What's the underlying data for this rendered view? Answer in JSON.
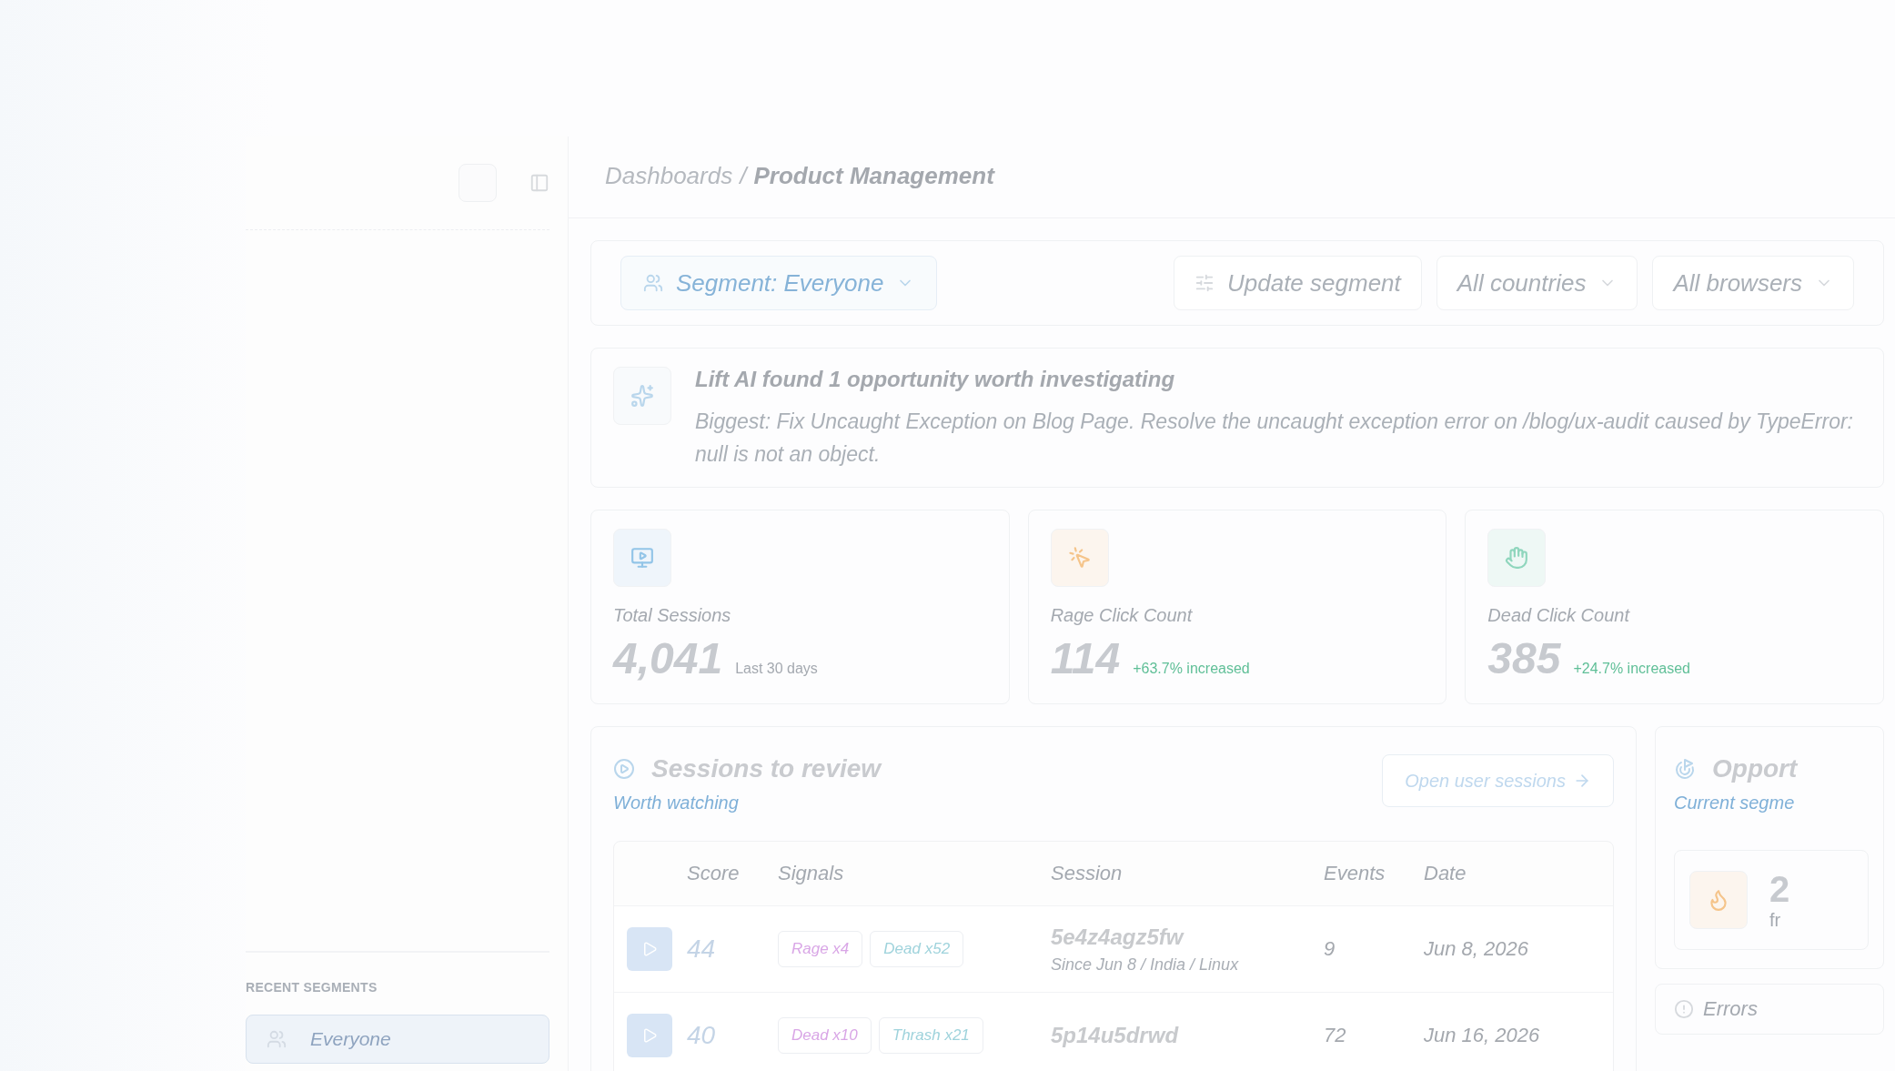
{
  "sidebar": {
    "section_title": "RECENT SEGMENTS",
    "segments": [
      {
        "label": "Everyone",
        "selected": true
      }
    ]
  },
  "breadcrumb": {
    "parent": "Dashboards",
    "separator": "/",
    "current": "Product Management"
  },
  "filters": {
    "segment": "Segment: Everyone",
    "update": "Update segment",
    "dropdowns": [
      "All countries",
      "All browsers"
    ]
  },
  "insight": {
    "title": "Lift AI found 1 opportunity worth investigating",
    "body": "Biggest: Fix Uncaught Exception on Blog Page. Resolve the uncaught exception error on /blog/ux-audit caused by TypeError: null is not an object."
  },
  "stats": [
    {
      "kind": "sessions",
      "label": "Total Sessions",
      "value": "4,041",
      "note": "Last 30 days",
      "color": "#93c5e8"
    },
    {
      "kind": "rage",
      "label": "Rage Click Count",
      "value": "114",
      "note": "+63.7% increased",
      "color": "#f5c48a"
    },
    {
      "kind": "dead",
      "label": "Dead Click Count",
      "value": "385",
      "note": "+24.7% increased",
      "color": "#8fd6bd"
    }
  ],
  "sessions": {
    "title": "Sessions to review",
    "subtitle": "Worth watching",
    "action": "Open user sessions",
    "columns": [
      "Score",
      "Signals",
      "Session",
      "Events",
      "Date"
    ],
    "rows": [
      {
        "score": "44",
        "signals": [
          {
            "label": "Rage x4",
            "color": "#d9a6e6"
          },
          {
            "label": "Dead x52",
            "color": "#9fd3dc"
          }
        ],
        "session": "5e4z4agz5fw",
        "meta": "Since Jun 8 / India / Linux",
        "events": "9",
        "date": "Jun 8, 2026"
      },
      {
        "score": "40",
        "signals": [
          {
            "label": "Dead x10",
            "color": "#d9a6e6"
          },
          {
            "label": "Thrash x21",
            "color": "#9fd3dc"
          }
        ],
        "session": "5p14u5drwd",
        "events": "72",
        "date": "Jun 16, 2026"
      }
    ]
  },
  "opportunities": {
    "title": "Opport",
    "subtitle": "Current segme",
    "value": "2",
    "note": "fr",
    "errors": "Errors"
  }
}
